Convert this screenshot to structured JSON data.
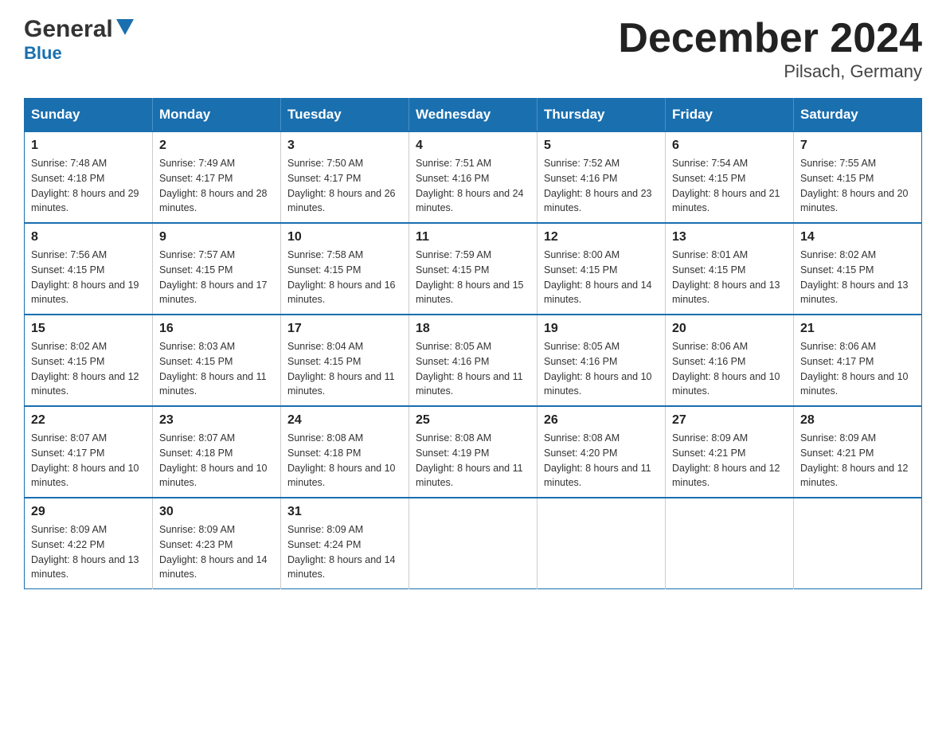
{
  "header": {
    "logo_line1": "General",
    "logo_line2": "Blue",
    "month_title": "December 2024",
    "location": "Pilsach, Germany"
  },
  "weekdays": [
    "Sunday",
    "Monday",
    "Tuesday",
    "Wednesday",
    "Thursday",
    "Friday",
    "Saturday"
  ],
  "weeks": [
    [
      {
        "day": "1",
        "sunrise": "7:48 AM",
        "sunset": "4:18 PM",
        "daylight": "8 hours and 29 minutes."
      },
      {
        "day": "2",
        "sunrise": "7:49 AM",
        "sunset": "4:17 PM",
        "daylight": "8 hours and 28 minutes."
      },
      {
        "day": "3",
        "sunrise": "7:50 AM",
        "sunset": "4:17 PM",
        "daylight": "8 hours and 26 minutes."
      },
      {
        "day": "4",
        "sunrise": "7:51 AM",
        "sunset": "4:16 PM",
        "daylight": "8 hours and 24 minutes."
      },
      {
        "day": "5",
        "sunrise": "7:52 AM",
        "sunset": "4:16 PM",
        "daylight": "8 hours and 23 minutes."
      },
      {
        "day": "6",
        "sunrise": "7:54 AM",
        "sunset": "4:15 PM",
        "daylight": "8 hours and 21 minutes."
      },
      {
        "day": "7",
        "sunrise": "7:55 AM",
        "sunset": "4:15 PM",
        "daylight": "8 hours and 20 minutes."
      }
    ],
    [
      {
        "day": "8",
        "sunrise": "7:56 AM",
        "sunset": "4:15 PM",
        "daylight": "8 hours and 19 minutes."
      },
      {
        "day": "9",
        "sunrise": "7:57 AM",
        "sunset": "4:15 PM",
        "daylight": "8 hours and 17 minutes."
      },
      {
        "day": "10",
        "sunrise": "7:58 AM",
        "sunset": "4:15 PM",
        "daylight": "8 hours and 16 minutes."
      },
      {
        "day": "11",
        "sunrise": "7:59 AM",
        "sunset": "4:15 PM",
        "daylight": "8 hours and 15 minutes."
      },
      {
        "day": "12",
        "sunrise": "8:00 AM",
        "sunset": "4:15 PM",
        "daylight": "8 hours and 14 minutes."
      },
      {
        "day": "13",
        "sunrise": "8:01 AM",
        "sunset": "4:15 PM",
        "daylight": "8 hours and 13 minutes."
      },
      {
        "day": "14",
        "sunrise": "8:02 AM",
        "sunset": "4:15 PM",
        "daylight": "8 hours and 13 minutes."
      }
    ],
    [
      {
        "day": "15",
        "sunrise": "8:02 AM",
        "sunset": "4:15 PM",
        "daylight": "8 hours and 12 minutes."
      },
      {
        "day": "16",
        "sunrise": "8:03 AM",
        "sunset": "4:15 PM",
        "daylight": "8 hours and 11 minutes."
      },
      {
        "day": "17",
        "sunrise": "8:04 AM",
        "sunset": "4:15 PM",
        "daylight": "8 hours and 11 minutes."
      },
      {
        "day": "18",
        "sunrise": "8:05 AM",
        "sunset": "4:16 PM",
        "daylight": "8 hours and 11 minutes."
      },
      {
        "day": "19",
        "sunrise": "8:05 AM",
        "sunset": "4:16 PM",
        "daylight": "8 hours and 10 minutes."
      },
      {
        "day": "20",
        "sunrise": "8:06 AM",
        "sunset": "4:16 PM",
        "daylight": "8 hours and 10 minutes."
      },
      {
        "day": "21",
        "sunrise": "8:06 AM",
        "sunset": "4:17 PM",
        "daylight": "8 hours and 10 minutes."
      }
    ],
    [
      {
        "day": "22",
        "sunrise": "8:07 AM",
        "sunset": "4:17 PM",
        "daylight": "8 hours and 10 minutes."
      },
      {
        "day": "23",
        "sunrise": "8:07 AM",
        "sunset": "4:18 PM",
        "daylight": "8 hours and 10 minutes."
      },
      {
        "day": "24",
        "sunrise": "8:08 AM",
        "sunset": "4:18 PM",
        "daylight": "8 hours and 10 minutes."
      },
      {
        "day": "25",
        "sunrise": "8:08 AM",
        "sunset": "4:19 PM",
        "daylight": "8 hours and 11 minutes."
      },
      {
        "day": "26",
        "sunrise": "8:08 AM",
        "sunset": "4:20 PM",
        "daylight": "8 hours and 11 minutes."
      },
      {
        "day": "27",
        "sunrise": "8:09 AM",
        "sunset": "4:21 PM",
        "daylight": "8 hours and 12 minutes."
      },
      {
        "day": "28",
        "sunrise": "8:09 AM",
        "sunset": "4:21 PM",
        "daylight": "8 hours and 12 minutes."
      }
    ],
    [
      {
        "day": "29",
        "sunrise": "8:09 AM",
        "sunset": "4:22 PM",
        "daylight": "8 hours and 13 minutes."
      },
      {
        "day": "30",
        "sunrise": "8:09 AM",
        "sunset": "4:23 PM",
        "daylight": "8 hours and 14 minutes."
      },
      {
        "day": "31",
        "sunrise": "8:09 AM",
        "sunset": "4:24 PM",
        "daylight": "8 hours and 14 minutes."
      },
      null,
      null,
      null,
      null
    ]
  ]
}
